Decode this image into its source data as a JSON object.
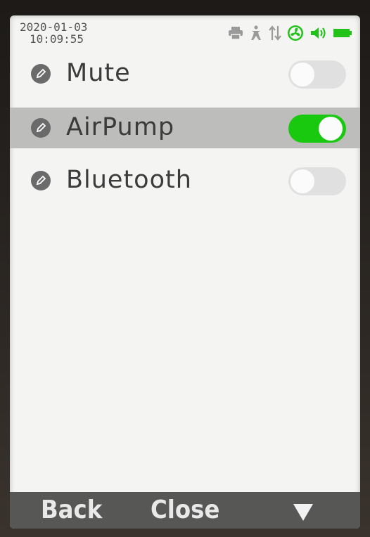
{
  "status": {
    "date": "2020-01-03",
    "time": "10:09:55",
    "icons": [
      "printer-icon",
      "person-icon",
      "transfer-arrows-icon",
      "fan-icon",
      "speaker-icon",
      "battery-icon"
    ]
  },
  "settings": [
    {
      "label": "Mute",
      "enabled": false,
      "selected": false
    },
    {
      "label": "AirPump",
      "enabled": true,
      "selected": true
    },
    {
      "label": "Bluetooth",
      "enabled": false,
      "selected": false
    }
  ],
  "softkeys": {
    "back": "Back",
    "close": "Close"
  },
  "colors": {
    "toggle_on": "#19c90f",
    "status_green": "#22c21a",
    "selected_row": "#bdbdbb",
    "softkey_bar": "#575756"
  }
}
